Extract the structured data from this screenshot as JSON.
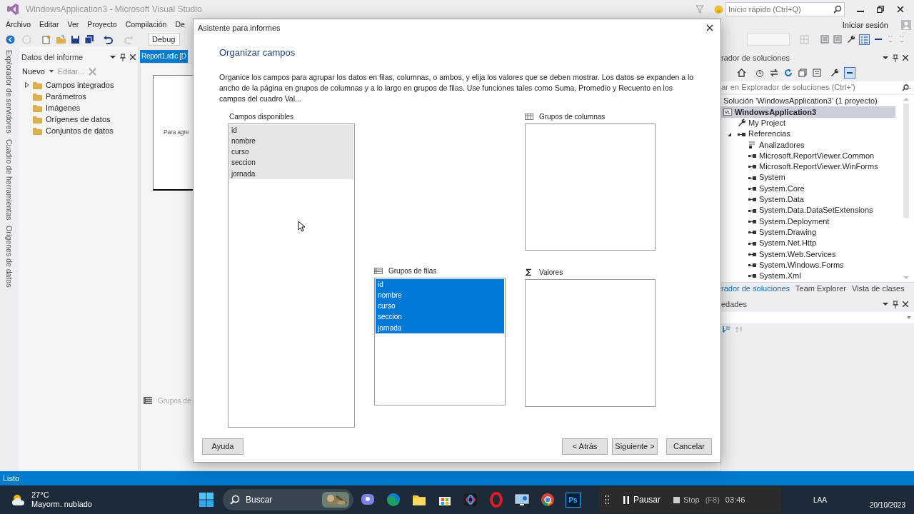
{
  "window": {
    "title": "WindowsApplication3 - Microsoft Visual Studio"
  },
  "quick_launch": {
    "placeholder": "Inicio rápido (Ctrl+Q)"
  },
  "menu": [
    "Archivo",
    "Editar",
    "Ver",
    "Proyecto",
    "Compilación",
    "De"
  ],
  "sign_in": "Iniciar sesión",
  "toolbar": {
    "configuration": "Debug"
  },
  "side_tabs": [
    "Explorador de servidores",
    "Cuadro de herramientas",
    "Orígenes de datos"
  ],
  "report_data": {
    "title": "Datos del informe",
    "new": "Nuevo",
    "edit": "Editar...",
    "items": [
      {
        "label": "Campos integrados",
        "expandable": true
      },
      {
        "label": "Parámetros",
        "expandable": false
      },
      {
        "label": "Imágenes",
        "expandable": false
      },
      {
        "label": "Orígenes de datos",
        "expandable": false
      },
      {
        "label": "Conjuntos de datos",
        "expandable": false
      }
    ]
  },
  "document": {
    "tab": "Report1.rdlc [D",
    "hint": "Para agre",
    "row_groups": "Grupos de"
  },
  "solution_explorer": {
    "title": "rador de soluciones",
    "search": {
      "placeholder": "ar en Explorador de soluciones (Ctrl+')"
    },
    "tree": [
      {
        "label": "Solución 'WindowsApplication3'  (1 proyecto)",
        "selected": false,
        "children": [
          {
            "label": "WindowsApplication3",
            "kind": "project",
            "selected": true,
            "children": [
              {
                "label": "My Project",
                "kind": "settings",
                "selected": false
              },
              {
                "label": "Referencias",
                "kind": "references",
                "selected": false,
                "expanded": true,
                "children": [
                  {
                    "label": "Analizadores",
                    "kind": "analyzer",
                    "selected": false
                  },
                  {
                    "label": "Microsoft.ReportViewer.Common",
                    "kind": "assembly",
                    "selected": false
                  },
                  {
                    "label": "Microsoft.ReportViewer.WinForms",
                    "kind": "assembly",
                    "selected": false
                  },
                  {
                    "label": "System",
                    "kind": "assembly",
                    "selected": false
                  },
                  {
                    "label": "System.Core",
                    "kind": "assembly",
                    "selected": false
                  },
                  {
                    "label": "System.Data",
                    "kind": "assembly",
                    "selected": false
                  },
                  {
                    "label": "System.Data.DataSetExtensions",
                    "kind": "assembly",
                    "selected": false
                  },
                  {
                    "label": "System.Deployment",
                    "kind": "assembly",
                    "selected": false
                  },
                  {
                    "label": "System.Drawing",
                    "kind": "assembly",
                    "selected": false
                  },
                  {
                    "label": "System.Net.Http",
                    "kind": "assembly",
                    "selected": false
                  },
                  {
                    "label": "System.Web.Services",
                    "kind": "assembly",
                    "selected": false
                  },
                  {
                    "label": "System.Windows.Forms",
                    "kind": "assembly",
                    "selected": false
                  },
                  {
                    "label": "System.Xml",
                    "kind": "assembly",
                    "selected": false
                  }
                ]
              }
            ]
          }
        ]
      }
    ],
    "tabs": [
      {
        "label": "rador de soluciones",
        "selected": true
      },
      {
        "label": "Team Explorer",
        "selected": false
      },
      {
        "label": "Vista de clases",
        "selected": false
      }
    ]
  },
  "properties": {
    "title": "edades"
  },
  "status_bar": "Listo",
  "dialog": {
    "title": "Asistente para informes",
    "heading": "Organizar campos",
    "description": "Organice los campos para agrupar los datos en filas, columnas, o ambos, y elija los valores que se deben mostrar. Los datos se expanden a lo ancho de la página en grupos de columnas y a lo largo en grupos de filas. Use funciones tales como Suma, Promedio y Recuento en los campos del cuadro Val...",
    "lists": [
      {
        "label": "Campos disponibles",
        "kind": "fields",
        "focused": false,
        "items": [
          {
            "label": "id",
            "selected": true
          },
          {
            "label": "nombre",
            "selected": true
          },
          {
            "label": "curso",
            "selected": true
          },
          {
            "label": "seccion",
            "selected": true
          },
          {
            "label": "jornada",
            "selected": true
          }
        ]
      },
      {
        "label": "Grupos de columnas",
        "kind": "columns"
      },
      {
        "label": "Grupos de filas",
        "kind": "rows",
        "focused": true,
        "items": [
          {
            "label": "id",
            "selected": true
          },
          {
            "label": "nombre",
            "selected": true
          },
          {
            "label": "curso",
            "selected": true
          },
          {
            "label": "seccion",
            "selected": true
          },
          {
            "label": "jornada",
            "selected": true
          }
        ]
      },
      {
        "label": "Valores",
        "kind": "values"
      }
    ],
    "buttons": [
      {
        "label": "Ayuda",
        "kind": "help"
      },
      {
        "label": "< Atrás",
        "kind": "nav"
      },
      {
        "label": "Siguiente >",
        "kind": "nav"
      },
      {
        "label": "Cancelar",
        "kind": "cancel"
      }
    ]
  },
  "taskbar": {
    "weather": {
      "temperature": "27°C",
      "condition": "Mayorm. nublado"
    },
    "search": {
      "placeholder": "Buscar"
    },
    "apps": [
      {
        "kind": "chat"
      },
      {
        "kind": "browser"
      },
      {
        "kind": "folder"
      },
      {
        "kind": "store"
      },
      {
        "kind": "loop"
      },
      {
        "kind": "ring"
      },
      {
        "kind": "monitor"
      },
      {
        "kind": "chrome"
      },
      {
        "kind": "ps",
        "label": "Ps"
      }
    ],
    "recorder": {
      "pause": "Pausar",
      "stop": "Stop",
      "shortcut": "(F8)",
      "time": "03:46"
    },
    "tray": {
      "language": "LAA",
      "date": "20/10/2023"
    }
  }
}
